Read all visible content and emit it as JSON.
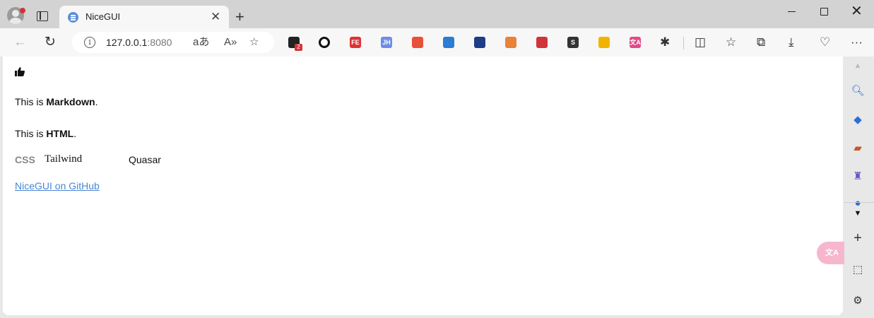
{
  "browser": {
    "tab_title": "NiceGUI",
    "url_host": "127.0.0.1",
    "url_port": ":8080",
    "extension_badge": "2",
    "extensions": [
      {
        "name": "ext-black",
        "color": "#222222",
        "label": ""
      },
      {
        "name": "ext-circle",
        "color": "#111111",
        "label": ""
      },
      {
        "name": "ext-fe",
        "color": "#e03131",
        "label": "FE"
      },
      {
        "name": "ext-jh",
        "color": "#6c8ce8",
        "label": "JH"
      },
      {
        "name": "ext-dice",
        "color": "#e8503a",
        "label": ""
      },
      {
        "name": "ext-edit",
        "color": "#2b7cd3",
        "label": ""
      },
      {
        "name": "ext-shield",
        "color": "#1f3c88",
        "label": ""
      },
      {
        "name": "ext-monitor",
        "color": "#e8823a",
        "label": ""
      },
      {
        "name": "ext-sync",
        "color": "#d13438",
        "label": ""
      },
      {
        "name": "ext-s",
        "color": "#333333",
        "label": "S"
      },
      {
        "name": "ext-cat",
        "color": "#f0b400",
        "label": ""
      },
      {
        "name": "ext-translate",
        "color": "#e04a8a",
        "label": "文A"
      }
    ]
  },
  "content": {
    "md_prefix": "This is ",
    "md_bold": "Markdown",
    "md_suffix": ".",
    "html_prefix": "This is ",
    "html_bold": "HTML",
    "html_suffix": ".",
    "css_label": "CSS",
    "tailwind": "Tailwind",
    "quasar": "Quasar",
    "link": "NiceGUI on GitHub",
    "float_button": "文A"
  },
  "colors": {
    "link": "#4a87d6",
    "accent_pink": "#f6b6cd"
  }
}
